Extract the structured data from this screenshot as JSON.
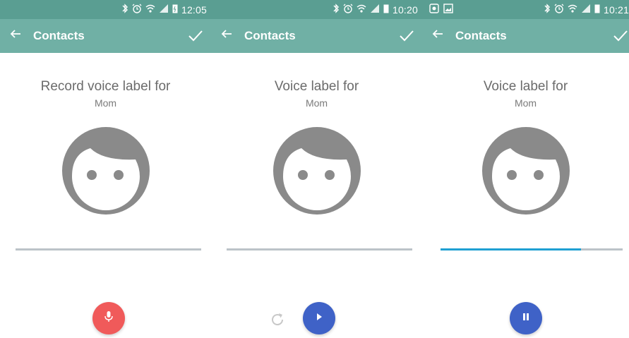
{
  "screens": [
    {
      "status": {
        "time": "12:05"
      },
      "appbar": {
        "title": "Contacts"
      },
      "heading": "Record voice label for",
      "contact_name": "Mom",
      "playback_progress": 0,
      "controls": [
        "mic-button"
      ]
    },
    {
      "status": {
        "time": "10:20"
      },
      "appbar": {
        "title": "Contacts"
      },
      "heading": "Voice label for",
      "contact_name": "Mom",
      "playback_progress": 0,
      "controls": [
        "redo-button",
        "play-button"
      ]
    },
    {
      "status": {
        "time": "10:21"
      },
      "appbar": {
        "title": "Contacts"
      },
      "heading": "Voice label for",
      "contact_name": "Mom",
      "playback_progress": 0.77,
      "controls": [
        "pause-button"
      ]
    }
  ],
  "colors": {
    "status_bar": "#5a9e92",
    "app_bar": "#70b0a5",
    "avatar": "#8a8a8a",
    "track": "#bcc3c8",
    "progress": "#1f9fd2",
    "record_fab": "#f05a5a",
    "play_fab": "#3f62c7"
  }
}
